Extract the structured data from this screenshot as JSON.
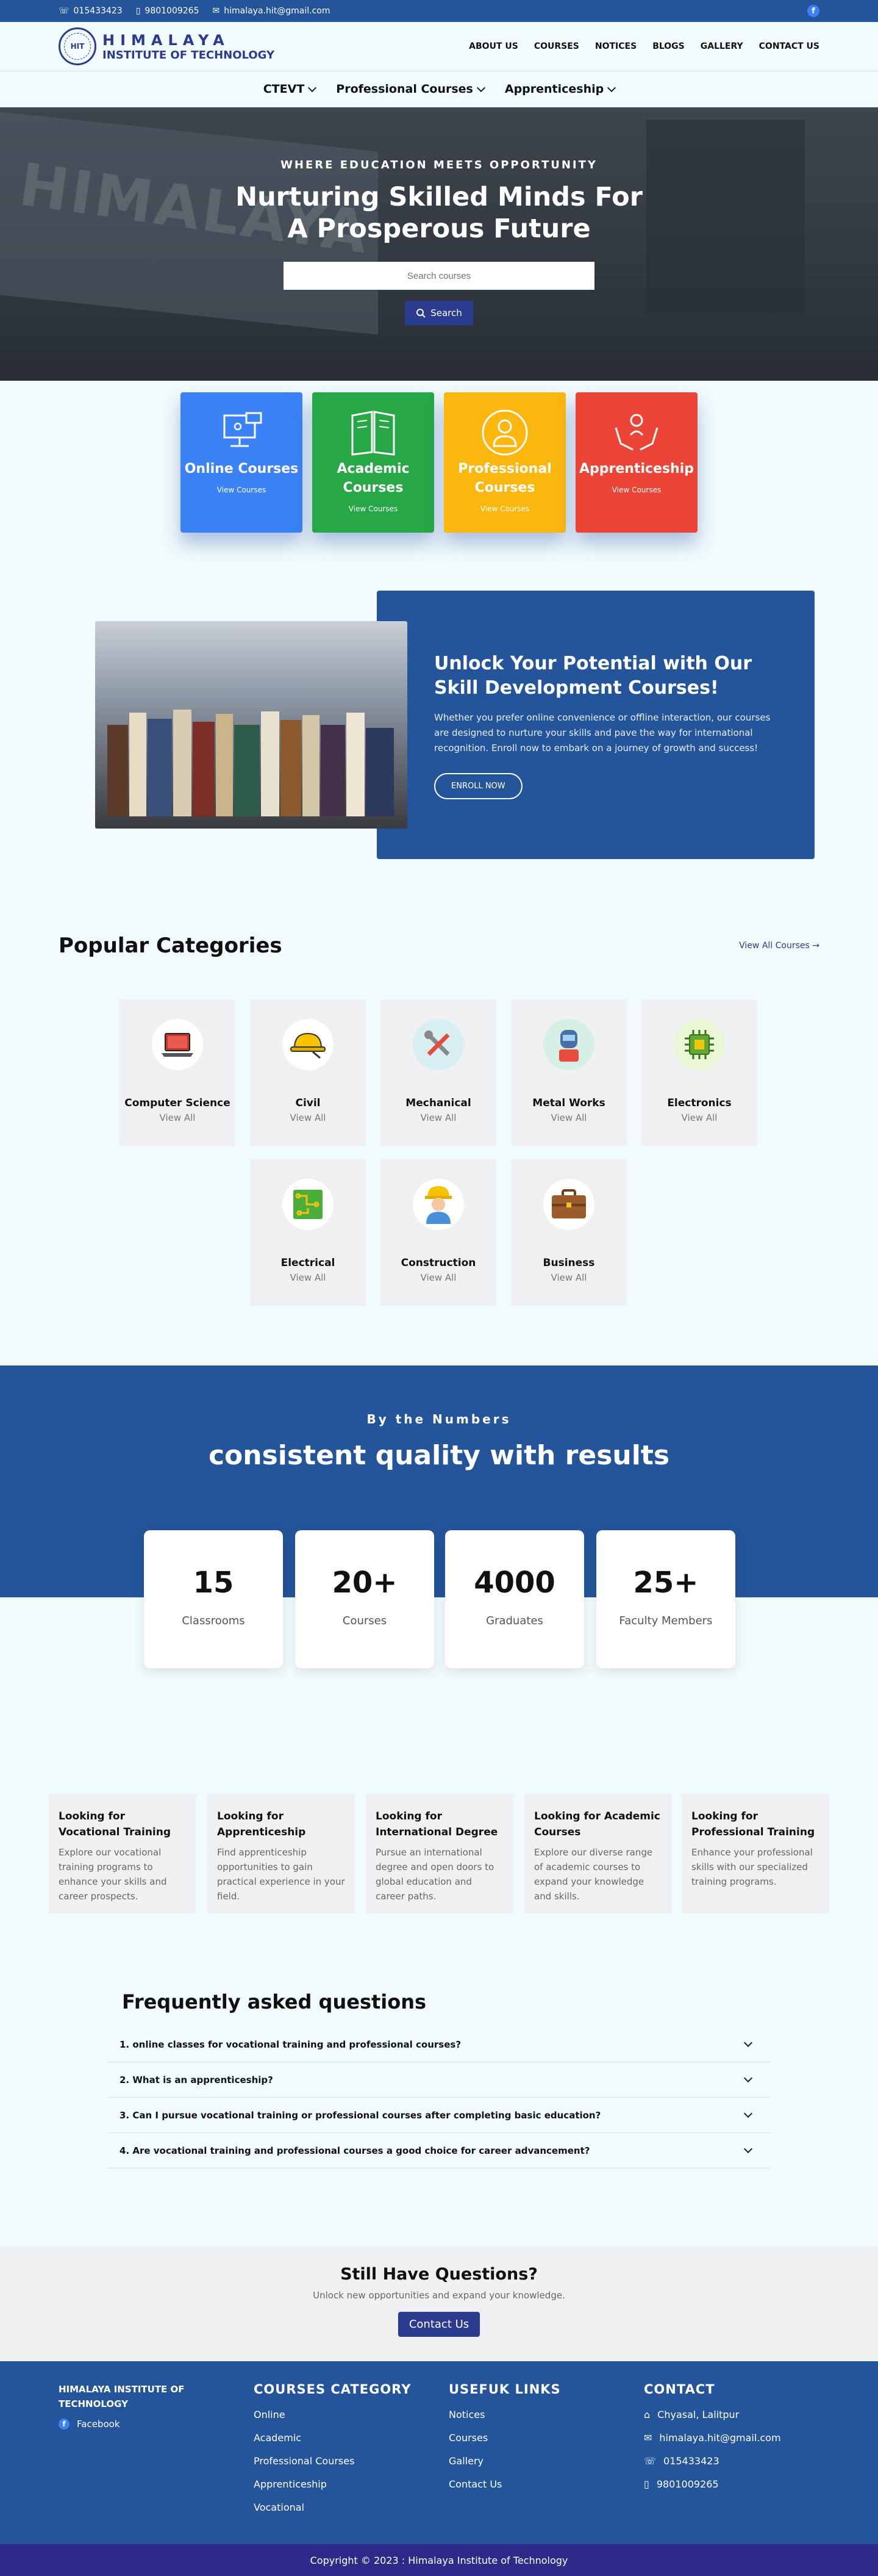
{
  "topbar": {
    "phone1": "015433423",
    "phone2": "9801009265",
    "email": "himalaya.hit@gmail.com"
  },
  "logo": {
    "line1": "HIMALAYA",
    "line2": "INSTITUTE OF TECHNOLOGY"
  },
  "mainnav": [
    "ABOUT US",
    "COURSES",
    "NOTICES",
    "BLOGS",
    "GALLERY",
    "CONTACT US"
  ],
  "subnav": [
    "CTEVT",
    "Professional Courses",
    "Apprenticeship"
  ],
  "hero": {
    "tagline": "WHERE EDUCATION MEETS OPPORTUNITY",
    "title": "Nurturing Skilled Minds For A Prosperous Future",
    "search_placeholder": "Search courses",
    "search_button": "Search",
    "bg_text": "HIMALAYA"
  },
  "cards": [
    {
      "title": "Online Courses",
      "link": "View Courses",
      "color": "#3b82f6"
    },
    {
      "title": "Academic Courses",
      "link": "View Courses",
      "color": "#27a745"
    },
    {
      "title": "Professional Courses",
      "link": "View Courses",
      "color": "#fbb70d"
    },
    {
      "title": "Apprenticeship",
      "link": "View Courses",
      "color": "#ec4436"
    }
  ],
  "promo": {
    "title": "Unlock Your Potential with Our Skill Development Courses!",
    "text": "Whether you prefer online convenience or offline interaction, our courses are designed to nurture your skills and pave the way for international recognition. Enroll now to embark on a journey of growth and success!",
    "button": "ENROLL NOW"
  },
  "popular": {
    "heading": "Popular Categories",
    "view_all": "View All Courses",
    "view_label": "View All",
    "categories": [
      {
        "name": "Computer Science",
        "icon": "laptop-icon"
      },
      {
        "name": "Civil",
        "icon": "hardhat-icon"
      },
      {
        "name": "Mechanical",
        "icon": "tools-icon"
      },
      {
        "name": "Metal Works",
        "icon": "welder-icon"
      },
      {
        "name": "Electronics",
        "icon": "chip-icon"
      },
      {
        "name": "Electrical",
        "icon": "circuit-icon"
      },
      {
        "name": "Construction",
        "icon": "worker-icon"
      },
      {
        "name": "Business",
        "icon": "briefcase-icon"
      }
    ]
  },
  "numbers": {
    "kicker": "By the Numbers",
    "heading": "consistent quality with results",
    "stats": [
      {
        "value": "15",
        "label": "Classrooms"
      },
      {
        "value": "20+",
        "label": "Courses"
      },
      {
        "value": "4000",
        "label": "Graduates"
      },
      {
        "value": "25+",
        "label": "Faculty Members"
      }
    ]
  },
  "looking": [
    {
      "title": "Looking for Vocational Training",
      "text": "Explore our vocational training programs to enhance your skills and career prospects."
    },
    {
      "title": "Looking for Apprenticeship",
      "text": "Find apprenticeship opportunities to gain practical experience in your field."
    },
    {
      "title": "Looking for International Degree",
      "text": "Pursue an international degree and open doors to global education and career paths."
    },
    {
      "title": "Looking for Academic Courses",
      "text": "Explore our diverse range of academic courses to expand your knowledge and skills."
    },
    {
      "title": "Looking for Professional Training",
      "text": "Enhance your professional skills with our specialized training programs."
    }
  ],
  "faq": {
    "heading": "Frequently asked questions",
    "items": [
      "1. online classes for vocational training and professional courses?",
      "2. What is an apprenticeship?",
      "3. Can I pursue vocational training or professional courses after completing basic education?",
      "4. Are vocational training and professional courses a good choice for career advancement?"
    ]
  },
  "still": {
    "heading": "Still Have Questions?",
    "text": "Unlock new opportunities and expand your knowledge.",
    "button": "Contact Us"
  },
  "footer": {
    "brand": "HIMALAYA INSTITUTE OF TECHNOLOGY",
    "facebook": "Facebook",
    "courses_heading": "COURSES CATEGORY",
    "courses": [
      "Online",
      "Academic",
      "Professional Courses",
      "Apprenticeship",
      "Vocational"
    ],
    "links_heading": "USEFUK LINKS",
    "links": [
      "Notices",
      "Courses",
      "Gallery",
      "Contact Us"
    ],
    "contact_heading": "CONTACT",
    "contact": {
      "address": "Chyasal, Lalitpur",
      "email": "himalaya.hit@gmail.com",
      "phone": "015433423",
      "mobile": "9801009265"
    }
  },
  "copyright": "Copyright © 2023 : Himalaya Institute of Technology"
}
